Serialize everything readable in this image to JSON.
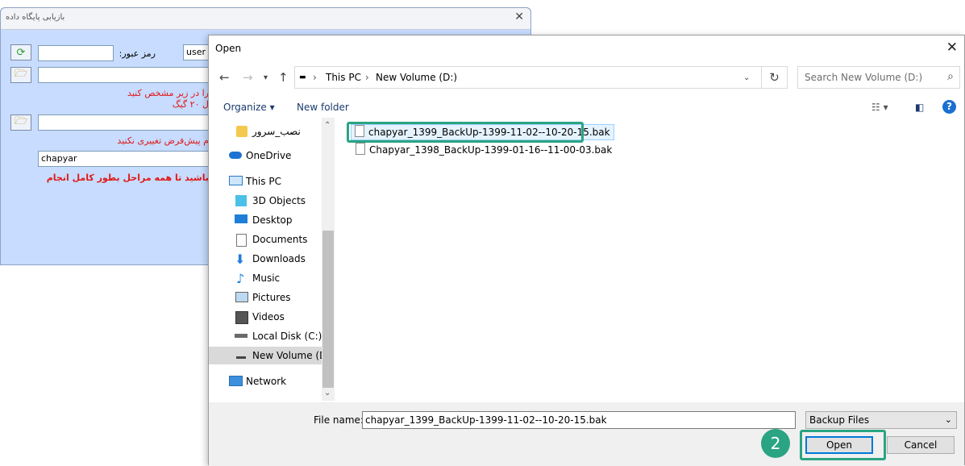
{
  "bg_window": {
    "title": "بازيابی پايگاه داده",
    "user_value": "user",
    "password_label": "رمز عبور:",
    "line1": "را در زیر مشخص کنید",
    "line2": "ل ۲۰ گیگ",
    "line3": "م پیش‌فرض تغییری نکنید",
    "db_name_value": "chapyar",
    "warning": "باشید تا همه مراحل بطور کامل انجام"
  },
  "dialog": {
    "title": "Open",
    "address": {
      "segments": [
        "This PC",
        "New Volume (D:)"
      ]
    },
    "search_placeholder": "Search New Volume (D:)",
    "organize_label": "Organize",
    "new_folder_label": "New folder",
    "nav": [
      {
        "label": "نصب_سرور",
        "icon": "folder-icon"
      },
      {
        "label": "OneDrive",
        "icon": "cloud-icon"
      },
      {
        "label": "This PC",
        "icon": "computer-icon"
      },
      {
        "label": "3D Objects",
        "icon": "cube-icon"
      },
      {
        "label": "Desktop",
        "icon": "desktop-icon"
      },
      {
        "label": "Documents",
        "icon": "documents-icon"
      },
      {
        "label": "Downloads",
        "icon": "download-icon"
      },
      {
        "label": "Music",
        "icon": "music-icon"
      },
      {
        "label": "Pictures",
        "icon": "pictures-icon"
      },
      {
        "label": "Videos",
        "icon": "videos-icon"
      },
      {
        "label": "Local Disk (C:)",
        "icon": "disk-icon"
      },
      {
        "label": "New Volume (D:)",
        "icon": "drive-icon",
        "selected": true
      },
      {
        "label": "Network",
        "icon": "network-icon"
      }
    ],
    "files": [
      {
        "name": "chapyar_1399_BackUp-1399-11-02--10-20-15.bak",
        "highlighted": true
      },
      {
        "name": "Chapyar_1398_BackUp-1399-01-16--11-00-03.bak"
      }
    ],
    "file_name_label": "File name:",
    "file_name_value": "chapyar_1399_BackUp-1399-11-02--10-20-15.bak",
    "file_type": "Backup Files",
    "open_label": "Open",
    "cancel_label": "Cancel"
  },
  "annotation": {
    "step_number": "2",
    "color": "#2aa482"
  },
  "colors": {
    "accent": "#0078d7",
    "bg_window": "#c7dcff",
    "warning": "#e01818"
  }
}
